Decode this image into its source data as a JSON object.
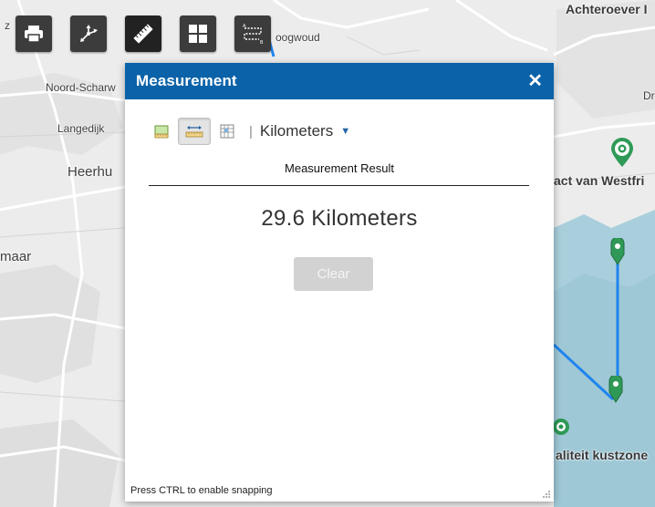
{
  "map": {
    "labels": {
      "top_left_fragment": "z",
      "town_1": "Noord-Scharw",
      "town_2": "Langedijk",
      "town_3": "Heerhu",
      "town_4": "maar",
      "town_5": "oogwoud",
      "top_right": "Achteroever I",
      "right_fragment": "Dr",
      "poi_1": "act van Westfri",
      "poi_2": "aliteit kustzone"
    },
    "colors": {
      "water": "#a9cfdc",
      "route": "#1f84ef",
      "marker": "#2f9a57"
    }
  },
  "toolbar": {
    "buttons": [
      {
        "name": "print",
        "icon": "printer-icon"
      },
      {
        "name": "locate",
        "icon": "location-arrows-icon"
      },
      {
        "name": "measure",
        "icon": "ruler-icon",
        "active": true
      },
      {
        "name": "basemap",
        "icon": "grid-icon"
      },
      {
        "name": "directions",
        "icon": "route-ab-icon"
      }
    ]
  },
  "panel": {
    "title": "Measurement",
    "close_symbol": "✕",
    "separator": "|",
    "unit": "Kilometers",
    "unit_caret": "▼",
    "result_title": "Measurement Result",
    "result_value": "29.6 Kilometers",
    "clear_label": "Clear",
    "snap_hint": "Press CTRL to enable snapping",
    "header_color": "#0a62a8"
  }
}
